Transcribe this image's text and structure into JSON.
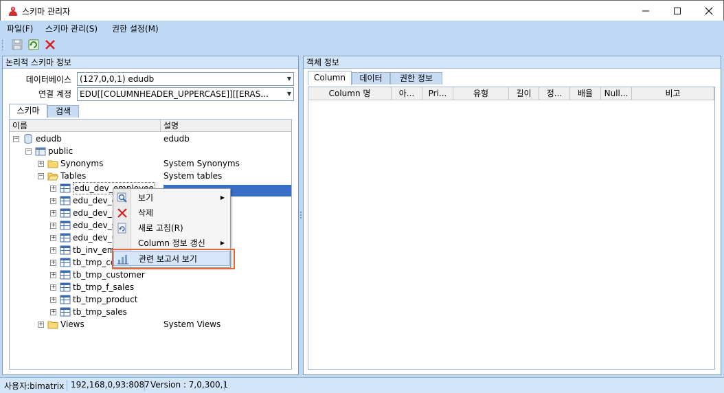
{
  "window": {
    "title": "스키마 관리자",
    "icons": {
      "app": "red-person-app-icon",
      "minimize": "minimize-icon",
      "maximize": "maximize-icon",
      "close": "close-icon"
    }
  },
  "menubar": {
    "items": [
      "파일(F)",
      "스키마 관리(S)",
      "권한 설정(M)"
    ]
  },
  "toolbar": {
    "buttons": [
      "save-icon",
      "refresh-icon",
      "delete-icon"
    ]
  },
  "left_pane": {
    "title": "논리적 스키마 정보",
    "database_label": "데이터베이스",
    "database_value": "(127,0,0,1) edudb",
    "connection_label": "연결 계정",
    "connection_value": "EDU[[COLUMNHEADER_UPPERCASE]][[ERAS...",
    "tabs": [
      "스키마",
      "검색"
    ],
    "tree_columns": [
      "이름",
      "설명"
    ],
    "tree": [
      {
        "name": "edudb",
        "desc": "edudb"
      },
      {
        "name": "public",
        "desc": ""
      },
      {
        "name": "Synonyms",
        "desc": "System Synonyms"
      },
      {
        "name": "Tables",
        "desc": "System tables"
      },
      {
        "name": "edu_dev_employee",
        "desc": ""
      },
      {
        "name": "edu_dev_e",
        "desc": ""
      },
      {
        "name": "edu_dev_n",
        "desc": ""
      },
      {
        "name": "edu_dev_s",
        "desc": ""
      },
      {
        "name": "edu_dev_u",
        "desc": ""
      },
      {
        "name": "tb_inv_em",
        "desc": ""
      },
      {
        "name": "tb_tmp_co",
        "desc": ""
      },
      {
        "name": "tb_tmp_customer",
        "desc": ""
      },
      {
        "name": "tb_tmp_f_sales",
        "desc": ""
      },
      {
        "name": "tb_tmp_product",
        "desc": ""
      },
      {
        "name": "tb_tmp_sales",
        "desc": ""
      },
      {
        "name": "Views",
        "desc": "System Views"
      }
    ]
  },
  "context_menu": {
    "items": [
      {
        "label": "보기",
        "submenu": "▶",
        "icon": "view-icon"
      },
      {
        "label": "삭제",
        "submenu": "",
        "icon": "delete-x-icon"
      },
      {
        "label": "새로 고침(R)",
        "submenu": "",
        "icon": "refresh-icon"
      },
      {
        "label": "Column 정보 갱신",
        "submenu": "▶",
        "icon": ""
      },
      {
        "label": "관련 보고서 보기",
        "submenu": "",
        "icon": "report-icon"
      }
    ]
  },
  "right_pane": {
    "title": "객체 정보",
    "tabs": [
      "Column",
      "데이터",
      "권한 정보"
    ],
    "grid_columns": [
      "Column 명",
      "아...",
      "Pri...",
      "유형",
      "길이",
      "정...",
      "배율",
      "Null...",
      "비고"
    ]
  },
  "statusbar": {
    "user": "사용자:bimatrix",
    "server": "192,168,0,93:8087",
    "version": "Version : 7,0,300,1"
  },
  "colors": {
    "selection": "#3a6fc8",
    "highlight_box": "#e06a3b",
    "chrome": "#bfd9f4"
  }
}
